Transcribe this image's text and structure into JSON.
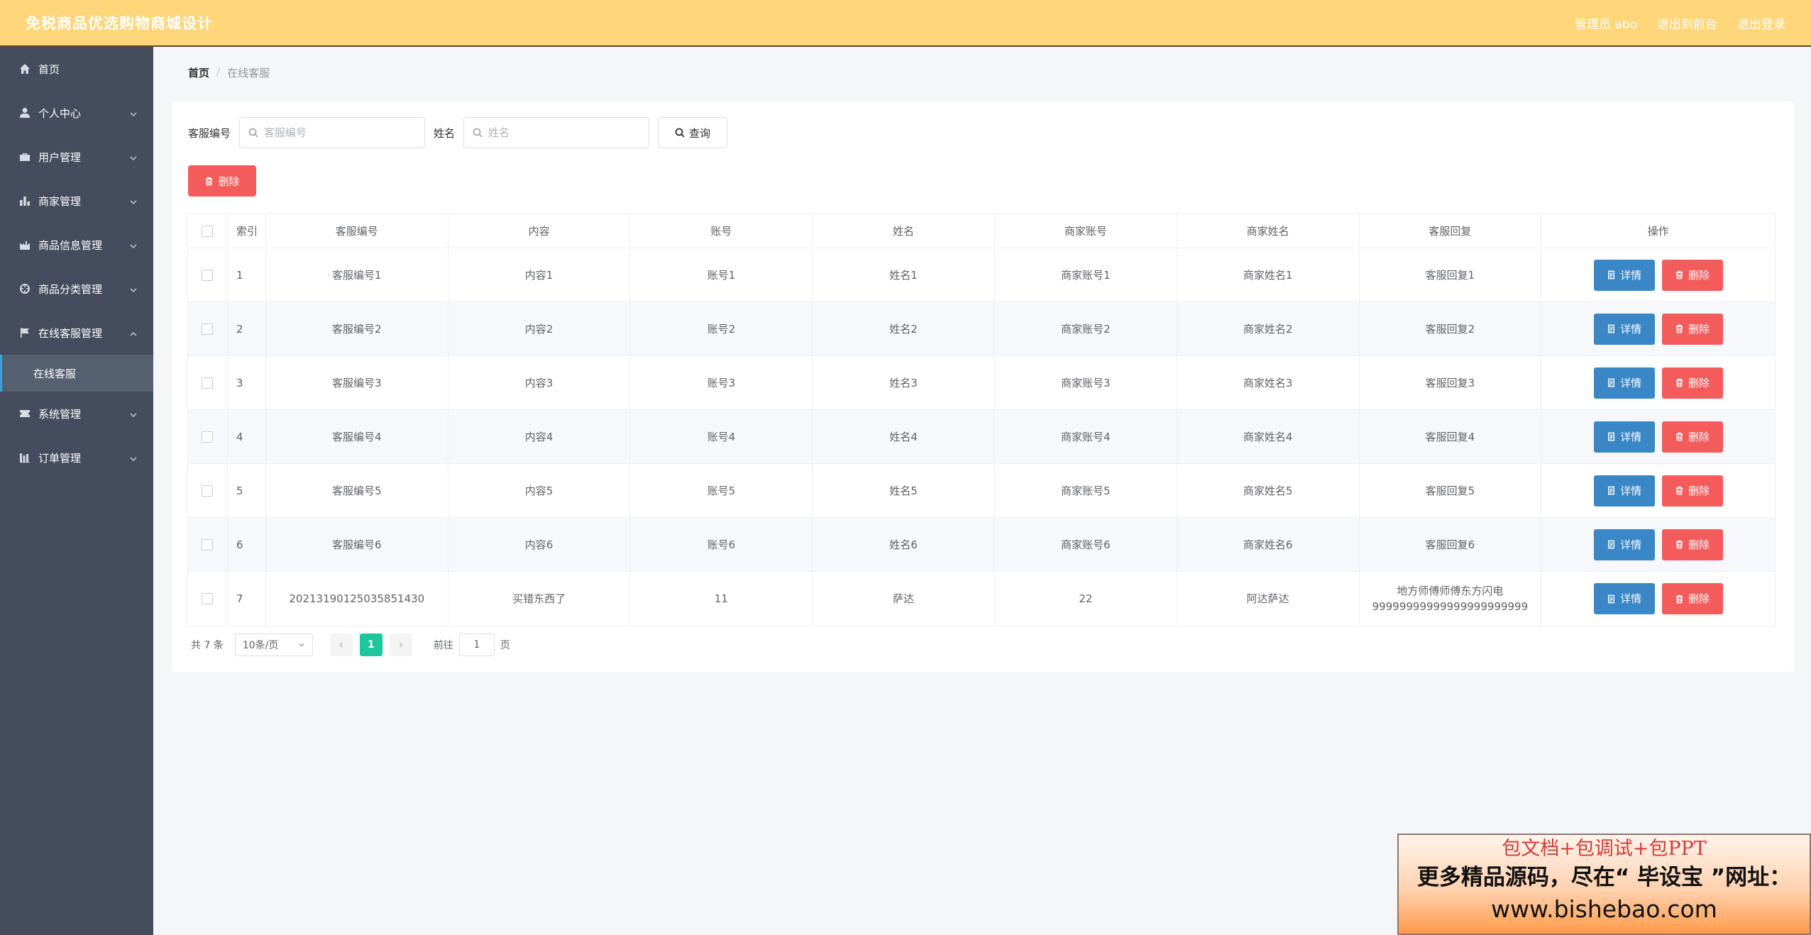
{
  "header": {
    "brand": "免税商品优选购物商城设计",
    "user_label": "管理员 abo",
    "front_link": "退出到前台",
    "logout_link": "退出登录"
  },
  "sidebar": {
    "items": [
      {
        "label": "首页",
        "icon": "home-icon"
      },
      {
        "label": "个人中心",
        "icon": "user-icon"
      },
      {
        "label": "用户管理",
        "icon": "briefcase-icon"
      },
      {
        "label": "商家管理",
        "icon": "bar-chart-icon"
      },
      {
        "label": "商品信息管理",
        "icon": "factory-icon"
      },
      {
        "label": "商品分类管理",
        "icon": "aperture-icon"
      },
      {
        "label": "在线客服管理",
        "icon": "flag-icon"
      },
      {
        "label": "系统管理",
        "icon": "ticket-icon"
      },
      {
        "label": "订单管理",
        "icon": "columns-icon"
      }
    ],
    "active_sub": "在线客服"
  },
  "breadcrumb": {
    "home": "首页",
    "separator": "/",
    "current": "在线客服"
  },
  "search": {
    "field1_label": "客服编号",
    "field1_placeholder": "客服编号",
    "field2_label": "姓名",
    "field2_placeholder": "姓名",
    "query_label": "查询"
  },
  "actions": {
    "bulk_delete_label": "删除"
  },
  "table": {
    "headers": [
      "索引",
      "客服编号",
      "内容",
      "账号",
      "姓名",
      "商家账号",
      "商家姓名",
      "客服回复",
      "操作"
    ],
    "detail_label": "详情",
    "delete_label": "删除",
    "rows": [
      {
        "idx": "1",
        "code": "客服编号1",
        "content": "内容1",
        "account": "账号1",
        "name": "姓名1",
        "merchant_account": "商家账号1",
        "merchant_name": "商家姓名1",
        "reply": "客服回复1"
      },
      {
        "idx": "2",
        "code": "客服编号2",
        "content": "内容2",
        "account": "账号2",
        "name": "姓名2",
        "merchant_account": "商家账号2",
        "merchant_name": "商家姓名2",
        "reply": "客服回复2"
      },
      {
        "idx": "3",
        "code": "客服编号3",
        "content": "内容3",
        "account": "账号3",
        "name": "姓名3",
        "merchant_account": "商家账号3",
        "merchant_name": "商家姓名3",
        "reply": "客服回复3"
      },
      {
        "idx": "4",
        "code": "客服编号4",
        "content": "内容4",
        "account": "账号4",
        "name": "姓名4",
        "merchant_account": "商家账号4",
        "merchant_name": "商家姓名4",
        "reply": "客服回复4"
      },
      {
        "idx": "5",
        "code": "客服编号5",
        "content": "内容5",
        "account": "账号5",
        "name": "姓名5",
        "merchant_account": "商家账号5",
        "merchant_name": "商家姓名5",
        "reply": "客服回复5"
      },
      {
        "idx": "6",
        "code": "客服编号6",
        "content": "内容6",
        "account": "账号6",
        "name": "姓名6",
        "merchant_account": "商家账号6",
        "merchant_name": "商家姓名6",
        "reply": "客服回复6"
      },
      {
        "idx": "7",
        "code": "20213190125035851430",
        "content": "买错东西了",
        "account": "11",
        "name": "萨达",
        "merchant_account": "22",
        "merchant_name": "阿达萨达",
        "reply": "地方师傅师傅东方闪电99999999999999999999999"
      }
    ]
  },
  "pagination": {
    "total": "共 7 条",
    "page_size": "10条/页",
    "current_page": "1",
    "goto_label": "前往",
    "goto_value": "1",
    "page_suffix": "页"
  },
  "promo": {
    "line1": "包文档+包调试+包PPT",
    "line2": "更多精品源码，尽在“ 毕设宝 ”网址：",
    "line3": "www.bishebao.com"
  },
  "colors": {
    "header_bg": "#ffd67a",
    "sidebar_bg": "#444c5e",
    "danger": "#f45b5b",
    "primary": "#3a87c8",
    "pager_active": "#1ec69b"
  }
}
